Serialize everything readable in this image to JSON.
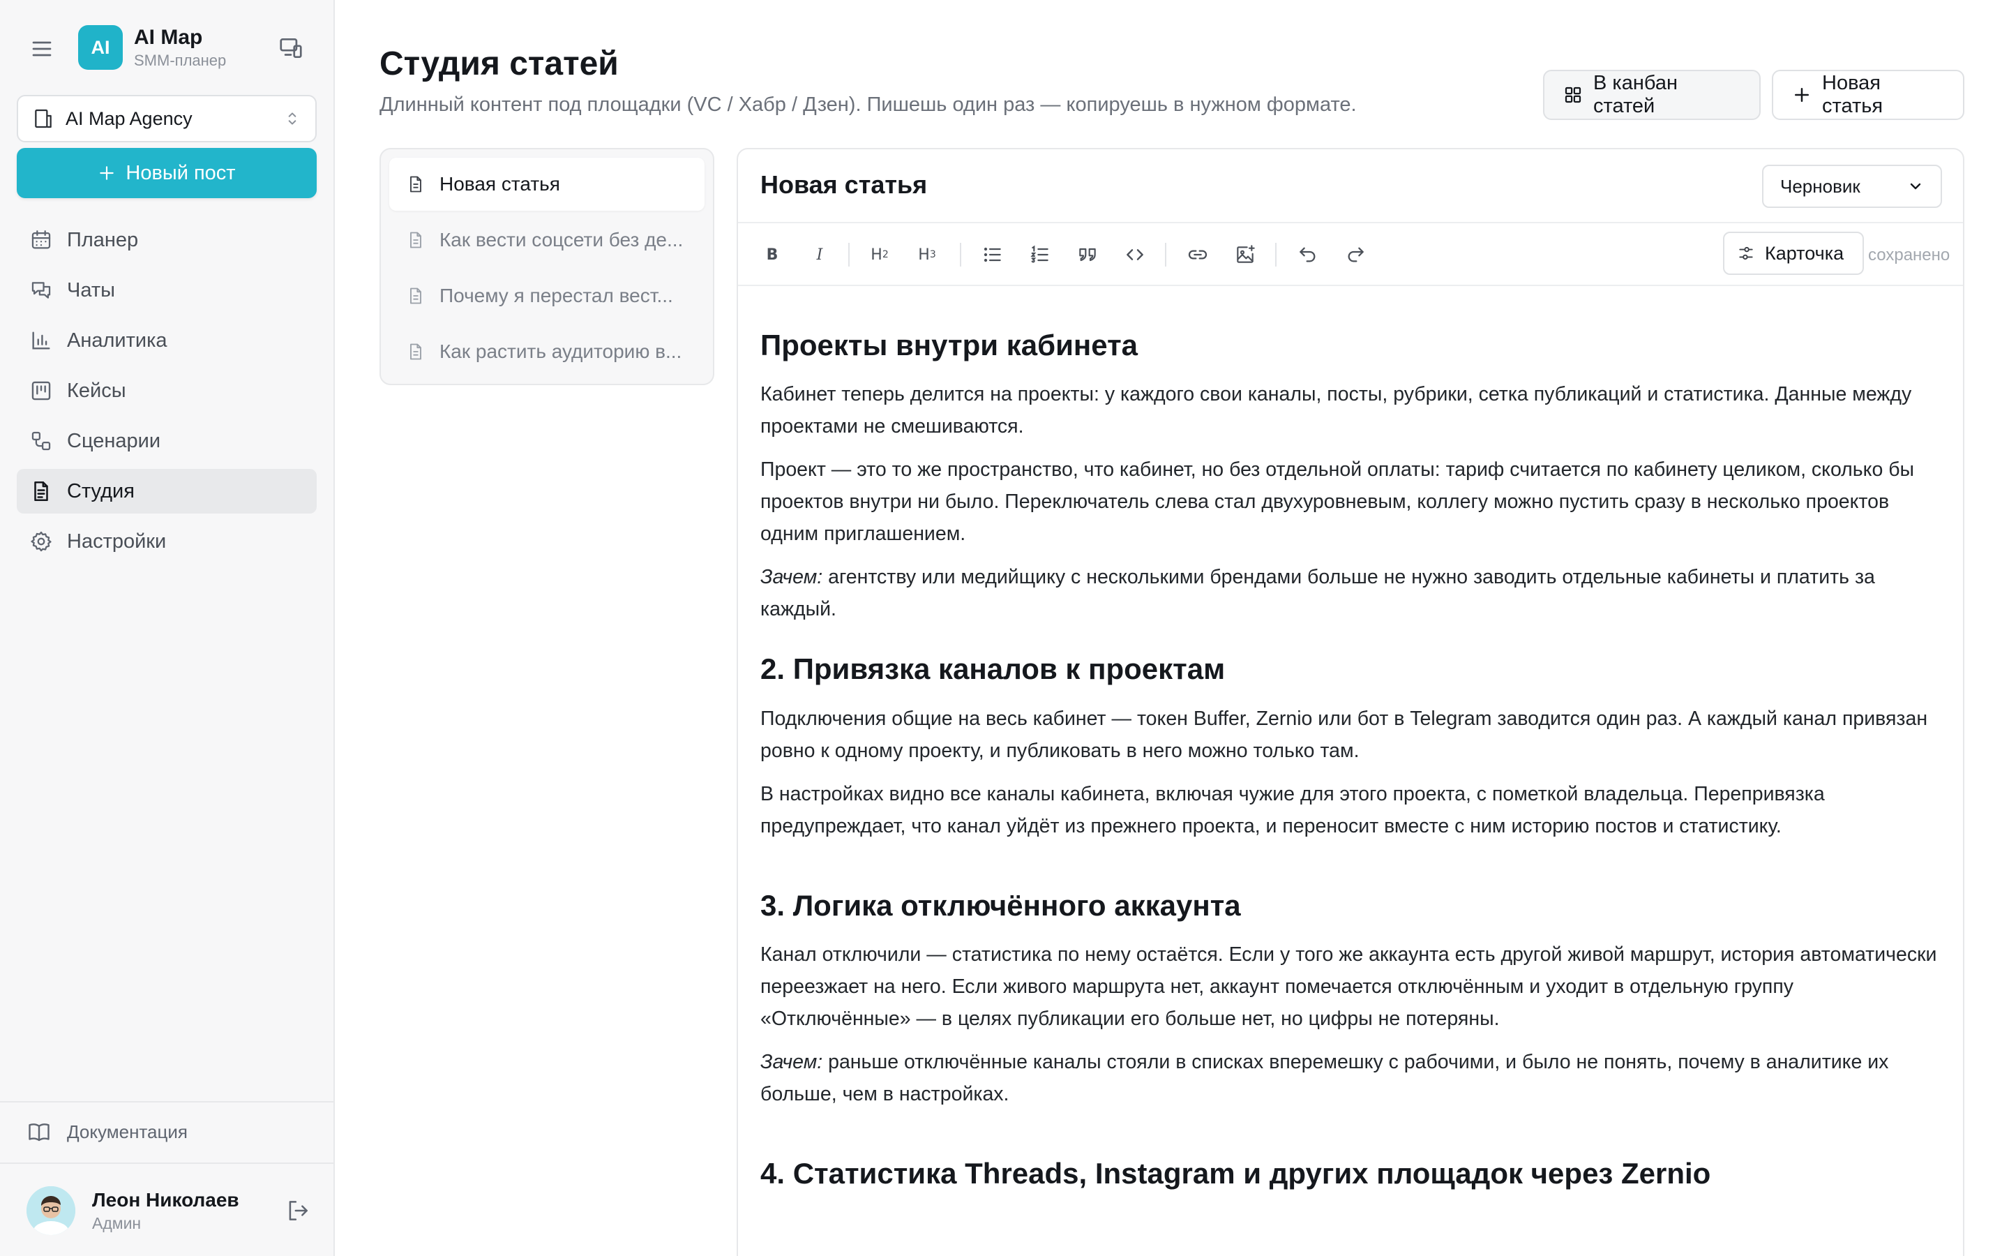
{
  "app": {
    "logo_text": "AI",
    "name": "AI Map",
    "subtitle": "SMM-планер"
  },
  "workspace": {
    "label": "AI Map Agency"
  },
  "new_post": {
    "label": "Новый пост"
  },
  "nav": {
    "items": [
      {
        "label": "Планер",
        "icon": "calendar-icon"
      },
      {
        "label": "Чаты",
        "icon": "chat-icon"
      },
      {
        "label": "Аналитика",
        "icon": "chart-icon"
      },
      {
        "label": "Кейсы",
        "icon": "kanban-icon"
      },
      {
        "label": "Сценарии",
        "icon": "workflow-icon"
      },
      {
        "label": "Студия",
        "icon": "document-icon"
      },
      {
        "label": "Настройки",
        "icon": "gear-icon"
      }
    ],
    "active": "Студия"
  },
  "docs": {
    "label": "Документация"
  },
  "user": {
    "name": "Леон Николаев",
    "role": "Админ"
  },
  "page": {
    "title": "Студия статей",
    "subtitle": "Длинный контент под площадки (VC / Хабр / Дзен). Пишешь один раз — копируешь в нужном формате.",
    "kanban_button": "В канбан статей",
    "new_article_button": "Новая статья"
  },
  "articles": [
    {
      "title": "Новая статья",
      "active": true
    },
    {
      "title": "Как вести соцсети без де...",
      "active": false
    },
    {
      "title": "Почему я перестал вест...",
      "active": false
    },
    {
      "title": "Как растить аудиторию в...",
      "active": false
    }
  ],
  "editor": {
    "title": "Новая статья",
    "status": "Черновик",
    "card_button": "Карточка",
    "saved_label": "сохранено",
    "toolbar": {
      "bold": "B",
      "italic": "I",
      "h2": "H",
      "h2_sub": "2",
      "h3": "H",
      "h3_sub": "3"
    },
    "content": {
      "h1": "Проекты внутри кабинета",
      "p1": "Кабинет теперь делится на проекты: у каждого свои каналы, посты, рубрики, сетка публикаций и статистика. Данные между проектами не смешиваются.",
      "p2": "Проект — это то же пространство, что кабинет, но без отдельной оплаты: тариф считается по кабинету целиком, сколько бы проектов внутри ни было. Переключатель слева стал двухуровневым, коллегу можно пустить сразу в несколько проектов одним приглашением.",
      "p3_em": "Зачем:",
      "p3": " агентству или медийщику с несколькими брендами больше не нужно заводить отдельные кабинеты и платить за каждый.",
      "h2": "2. Привязка каналов к проектам",
      "p4": "Подключения общие на весь кабинет — токен Buffer, Zernio или бот в Telegram заводится один раз. А каждый канал привязан ровно к одному проекту, и публиковать в него можно только там.",
      "p5": "В настройках видно все каналы кабинета, включая чужие для этого проекта, с пометкой владельца. Перепривязка предупреждает, что канал уйдёт из прежнего проекта, и переносит вместе с ним историю постов и статистику.",
      "h3": "3. Логика отключённого аккаунта",
      "p6": "Канал отключили — статистика по нему остаётся. Если у того же аккаунта есть другой живой маршрут, история автоматически переезжает на него. Если живого маршрута нет, аккаунт помечается отключённым и уходит в отдельную группу «Отключённые» — в целях публикации его больше нет, но цифры не потеряны.",
      "p7_em": "Зачем:",
      "p7": " раньше отключённые каналы стояли в списках вперемешку с рабочими, и было не понять, почему в аналитике их больше, чем в настройках.",
      "h4": "4. Статистика Threads, Instagram и других площадок через Zernio"
    }
  },
  "colors": {
    "accent": "#22b5cb",
    "sidebar_bg": "#f7f7f8",
    "active_nav_bg": "#e8e9eb"
  }
}
